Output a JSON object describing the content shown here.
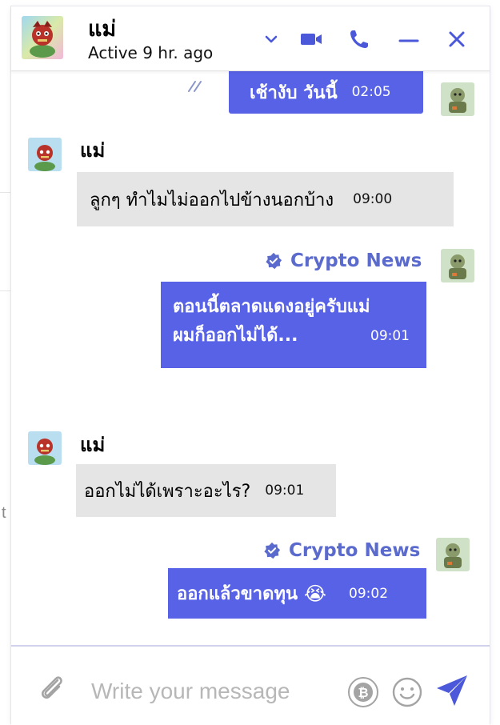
{
  "header": {
    "contact_name": "แม่",
    "status": "Active 9 hr. ago"
  },
  "messages": [
    {
      "direction": "out",
      "text": "เช้างับ วันนี้",
      "time": "02:05"
    },
    {
      "direction": "in",
      "sender": "แม่",
      "text": "ลูกๆ ทำไมไม่ออกไปข้างนอกบ้าง",
      "time": "09:00"
    },
    {
      "direction": "out",
      "sender": "Crypto News",
      "lines": [
        "ตอนนี้ตลาดแดงอยู่ครับแม่",
        "ผมก็ออกไม่ได้..."
      ],
      "time": "09:01"
    },
    {
      "direction": "in",
      "sender": "แม่",
      "text": "ออกไม่ได้เพราะอะไร?",
      "time": "09:01"
    },
    {
      "direction": "out",
      "sender": "Crypto News",
      "text": "ออกแล้วขาดทุน",
      "emoji": "😭",
      "time": "09:02"
    }
  ],
  "composer": {
    "placeholder": "Write your message"
  },
  "colors": {
    "accent": "#5862e6",
    "incoming_bubble": "#e5e5e5",
    "sender_out": "#5a6acd"
  },
  "icons": [
    "chevron-down-icon",
    "video-call-icon",
    "phone-icon",
    "minimize-icon",
    "close-icon",
    "read-receipt-icon",
    "verified-badge-icon",
    "attachment-icon",
    "bitcoin-icon",
    "emoji-icon",
    "send-icon"
  ]
}
